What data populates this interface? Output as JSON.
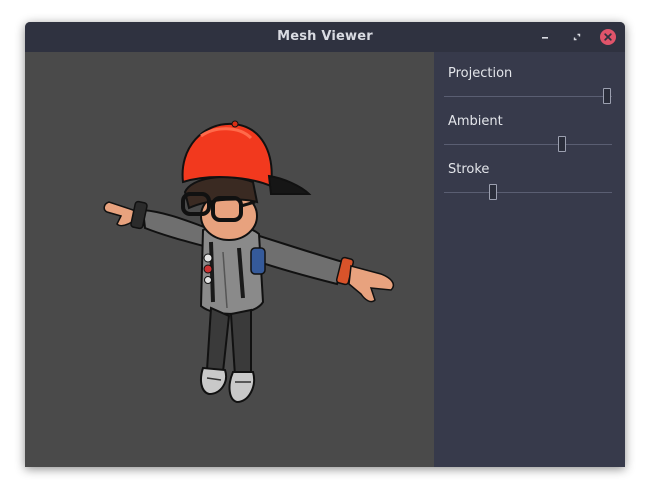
{
  "window": {
    "title": "Mesh Viewer"
  },
  "viewport": {
    "model_name": "cartoon-boy-t-pose"
  },
  "panel": {
    "sliders": [
      {
        "label": "Projection",
        "value": 0.97
      },
      {
        "label": "Ambient",
        "value": 0.7
      },
      {
        "label": "Stroke",
        "value": 0.29
      }
    ]
  },
  "colors": {
    "titlebar": "#2f3240",
    "panel": "#373a4b",
    "viewport": "#4a4a4a",
    "close_button": "#e0546a",
    "cap": "#f2391e"
  }
}
